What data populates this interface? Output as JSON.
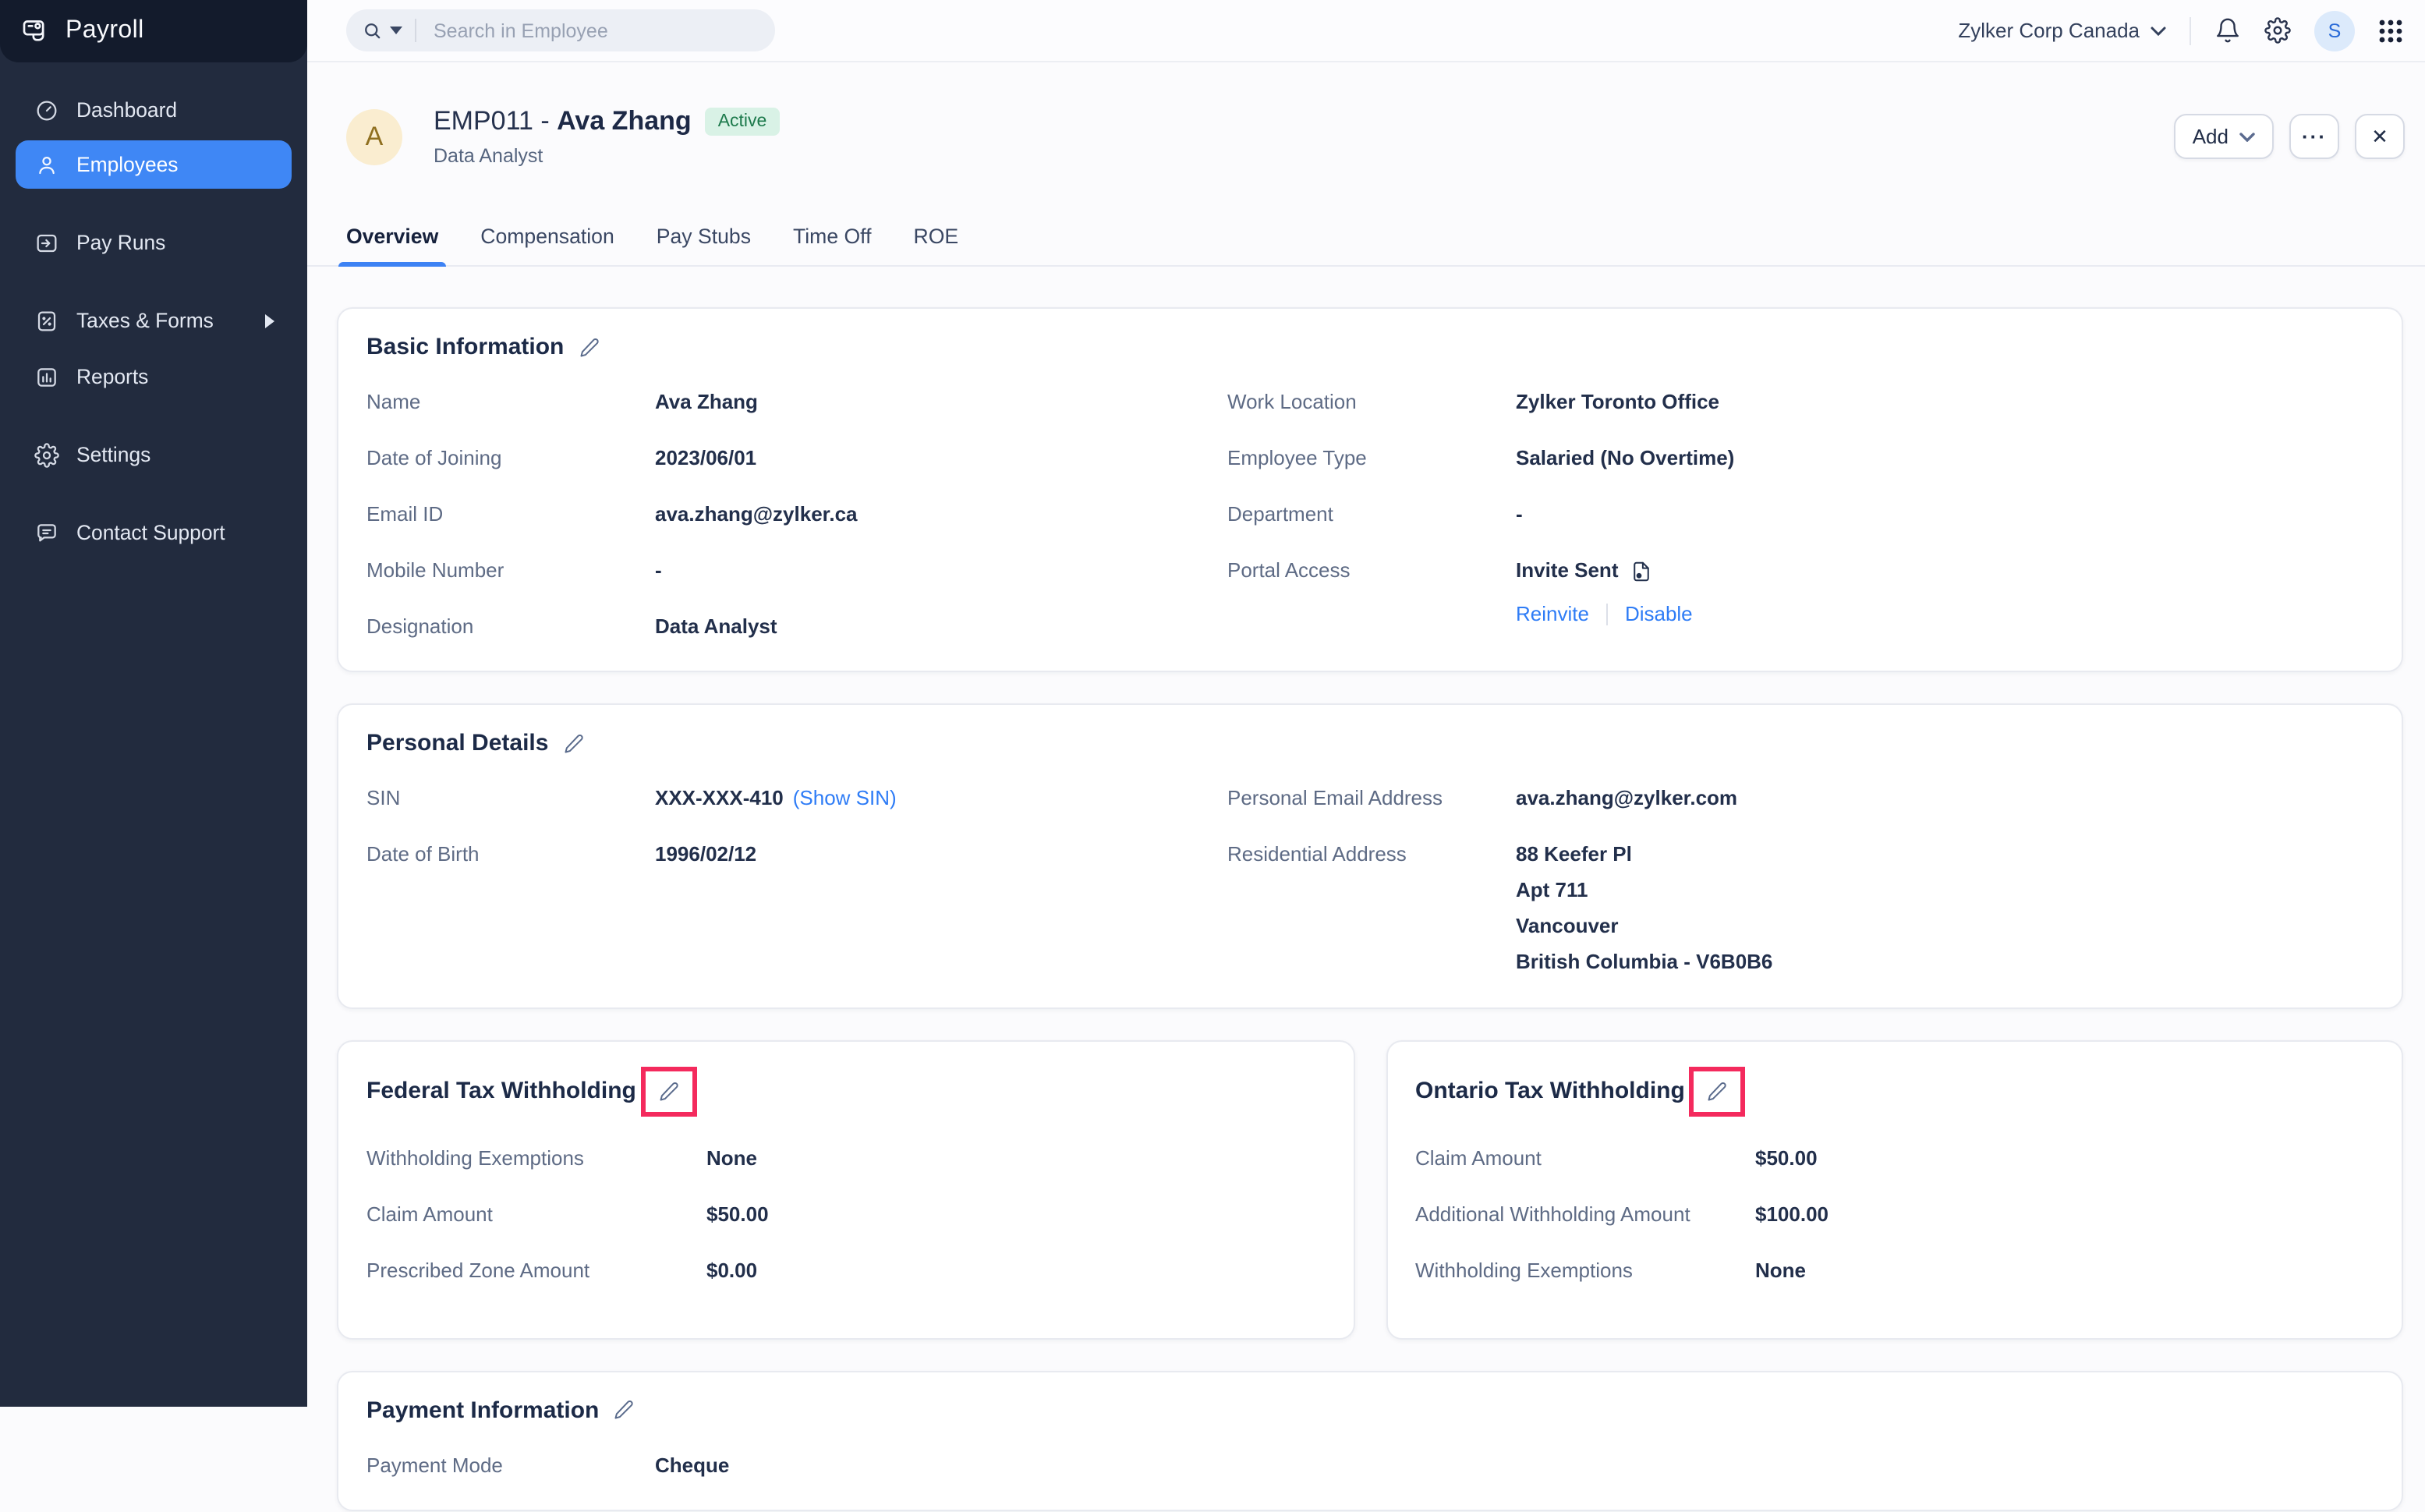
{
  "app": {
    "name": "Payroll"
  },
  "topbar": {
    "search_placeholder": "Search in Employee",
    "org_name": "Zylker Corp Canada",
    "user_initial": "S"
  },
  "sidebar": {
    "items": [
      {
        "label": "Dashboard"
      },
      {
        "label": "Employees",
        "active": true
      },
      {
        "label": "Pay Runs"
      },
      {
        "label": "Taxes & Forms",
        "has_submenu": true
      },
      {
        "label": "Reports"
      },
      {
        "label": "Settings"
      },
      {
        "label": "Contact Support"
      }
    ]
  },
  "employee": {
    "code_prefix": "EMP011 - ",
    "name": "Ava Zhang",
    "status_badge": "Active",
    "designation": "Data Analyst",
    "avatar_initial": "A"
  },
  "actions": {
    "add": "Add",
    "more": "···",
    "close": "✕"
  },
  "tabs": [
    {
      "label": "Overview",
      "active": true
    },
    {
      "label": "Compensation"
    },
    {
      "label": "Pay Stubs"
    },
    {
      "label": "Time Off"
    },
    {
      "label": "ROE"
    }
  ],
  "cards": {
    "basic_information": {
      "title": "Basic Information",
      "left_rows": [
        {
          "label": "Name",
          "value": "Ava Zhang"
        },
        {
          "label": "Date of Joining",
          "value": "2023/06/01"
        },
        {
          "label": "Email ID",
          "value": "ava.zhang@zylker.ca"
        },
        {
          "label": "Mobile Number",
          "value": "-"
        },
        {
          "label": "Designation",
          "value": "Data Analyst"
        }
      ],
      "right_rows": [
        {
          "label": "Work Location",
          "value": "Zylker Toronto Office"
        },
        {
          "label": "Employee Type",
          "value": "Salaried (No Overtime)"
        },
        {
          "label": "Department",
          "value": "-"
        }
      ],
      "portal_access": {
        "label": "Portal Access",
        "status": "Invite Sent",
        "reinvite": "Reinvite",
        "disable": "Disable"
      }
    },
    "personal_details": {
      "title": "Personal Details",
      "sin": {
        "label": "SIN",
        "value": "XXX-XXX-410",
        "show_link": "(Show SIN)"
      },
      "dob": {
        "label": "Date of Birth",
        "value": "1996/02/12"
      },
      "personal_email": {
        "label": "Personal Email Address",
        "value": "ava.zhang@zylker.com"
      },
      "residential_address": {
        "label": "Residential Address",
        "lines": [
          "88 Keefer Pl",
          "Apt 711",
          "Vancouver",
          "British Columbia - V6B0B6"
        ]
      }
    },
    "federal_tax": {
      "title": "Federal Tax Withholding",
      "rows": [
        {
          "label": "Withholding Exemptions",
          "value": "None"
        },
        {
          "label": "Claim Amount",
          "value": "$50.00"
        },
        {
          "label": "Prescribed Zone Amount",
          "value": "$0.00"
        }
      ]
    },
    "ontario_tax": {
      "title": "Ontario Tax Withholding",
      "rows": [
        {
          "label": "Claim Amount",
          "value": "$50.00"
        },
        {
          "label": "Additional Withholding Amount",
          "value": "$100.00"
        },
        {
          "label": "Withholding Exemptions",
          "value": "None"
        }
      ]
    },
    "payment_information": {
      "title": "Payment Information",
      "rows": [
        {
          "label": "Payment Mode",
          "value": "Cheque"
        }
      ]
    }
  },
  "colors": {
    "accent_blue": "#3F87F5",
    "link_blue": "#2E7CF6",
    "annotation_red": "#F42A5D",
    "badge_green_bg": "#D9F2E6",
    "badge_green_text": "#1D7A4C",
    "sidebar_bg": "#222B3E",
    "sidebar_header_bg": "#131B2C",
    "avatar_bg": "#FAEDD0"
  }
}
